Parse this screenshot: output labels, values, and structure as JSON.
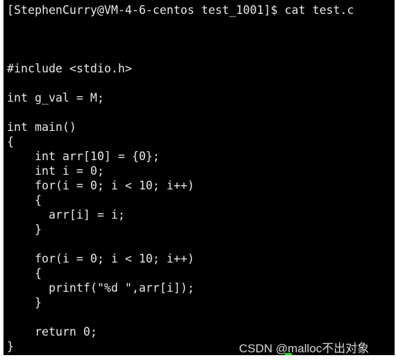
{
  "terminal": {
    "lines": [
      "[StephenCurry@VM-4-6-centos test_1001]$ cat test.c",
      "",
      "",
      "",
      "#include <stdio.h>",
      "",
      "int g_val = M;",
      "",
      "int main()",
      "{",
      "    int arr[10] = {0};",
      "    int i = 0;",
      "    for(i = 0; i < 10; i++)",
      "    {",
      "      arr[i] = i;",
      "    }",
      "",
      "    for(i = 0; i < 10; i++)",
      "    {",
      "      printf(\"%d \",arr[i]);",
      "    }",
      "",
      "    return 0;",
      "}"
    ],
    "cursor_color": "#22e022",
    "background": "#000000"
  },
  "watermark": "CSDN @malloc不出对象"
}
